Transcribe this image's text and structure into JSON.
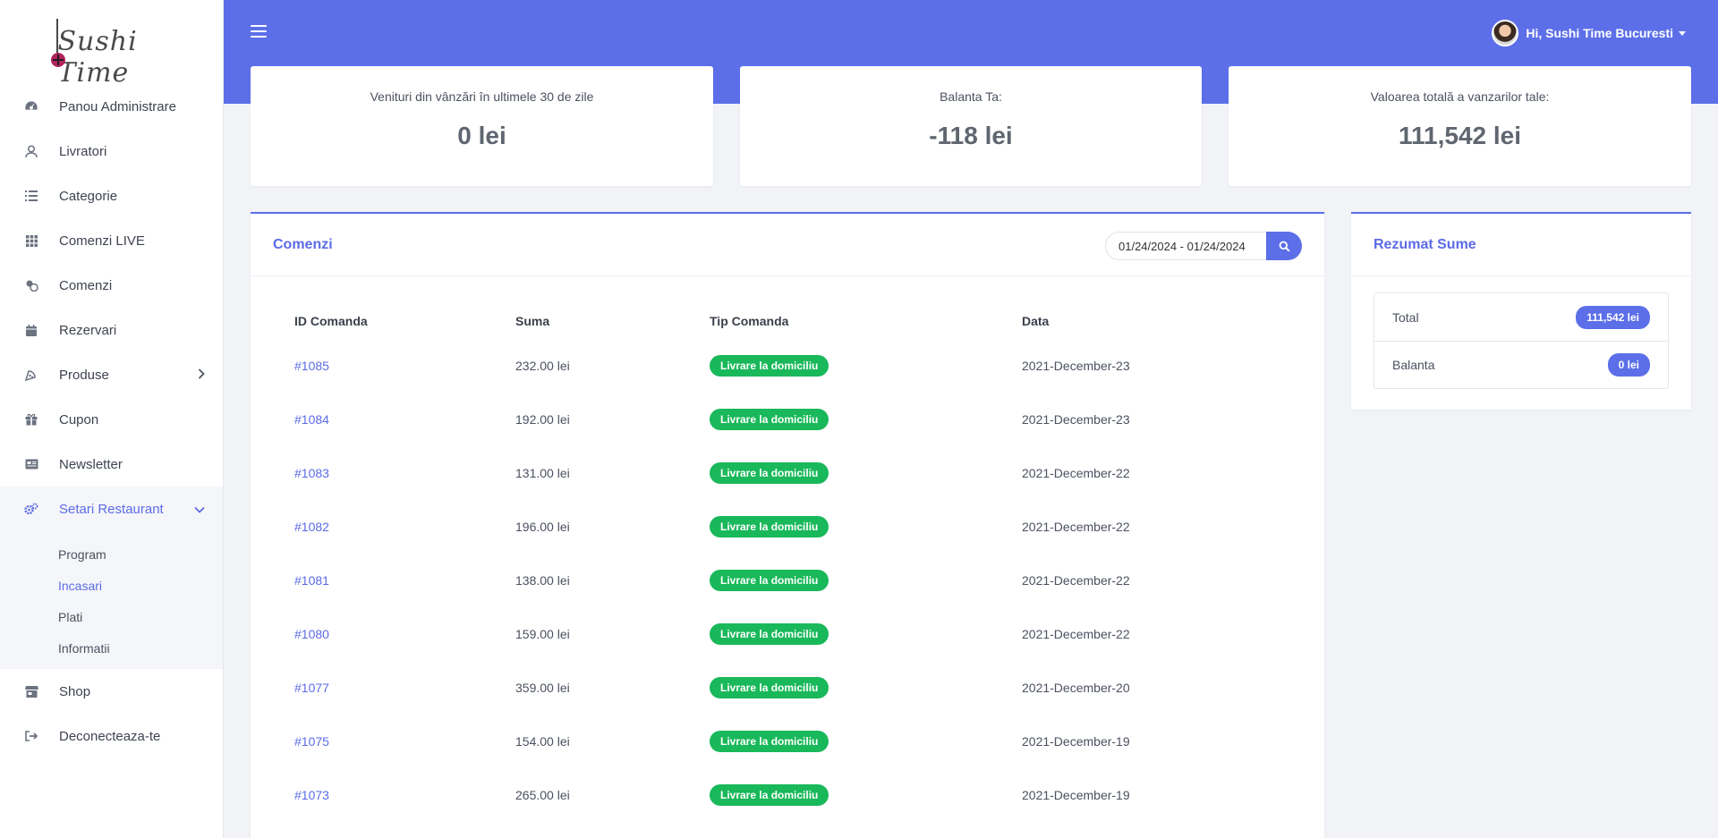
{
  "brand": {
    "logo_text": "Sushi Time"
  },
  "sidebar": {
    "items": [
      {
        "label": "Panou Administrare",
        "icon": "dashboard-gauge-icon"
      },
      {
        "label": "Livratori",
        "icon": "user-icon"
      },
      {
        "label": "Categorie",
        "icon": "list-icon"
      },
      {
        "label": "Comenzi LIVE",
        "icon": "grid-icon"
      },
      {
        "label": "Comenzi",
        "icon": "cookies-icon"
      },
      {
        "label": "Rezervari",
        "icon": "calendar-icon"
      },
      {
        "label": "Produse",
        "icon": "pizza-icon"
      },
      {
        "label": "Cupon",
        "icon": "gift-icon"
      },
      {
        "label": "Newsletter",
        "icon": "newspaper-icon"
      },
      {
        "label": "Setari Restaurant",
        "icon": "cogs-icon"
      },
      {
        "label": "Shop",
        "icon": "store-icon"
      },
      {
        "label": "Deconecteaza-te",
        "icon": "sign-out-icon"
      }
    ],
    "sub_items": [
      {
        "label": "Program"
      },
      {
        "label": "Incasari"
      },
      {
        "label": "Plati"
      },
      {
        "label": "Informatii"
      }
    ]
  },
  "header": {
    "greeting": "Hi, Sushi Time Bucuresti"
  },
  "stats": [
    {
      "label": "Venituri din vânzări în ultimele 30 de zile",
      "value": "0 lei"
    },
    {
      "label": "Balanta Ta:",
      "value": "-118 lei"
    },
    {
      "label": "Valoarea totală a vanzarilor tale:",
      "value": "111,542 lei"
    }
  ],
  "orders": {
    "title": "Comenzi",
    "date_range": "01/24/2024 - 01/24/2024",
    "columns": [
      "ID Comanda",
      "Suma",
      "Tip Comanda",
      "Data"
    ],
    "rows": [
      {
        "id": "#1085",
        "amount": "232.00 lei",
        "type": "Livrare la domiciliu",
        "date": "2021-December-23"
      },
      {
        "id": "#1084",
        "amount": "192.00 lei",
        "type": "Livrare la domiciliu",
        "date": "2021-December-23"
      },
      {
        "id": "#1083",
        "amount": "131.00 lei",
        "type": "Livrare la domiciliu",
        "date": "2021-December-22"
      },
      {
        "id": "#1082",
        "amount": "196.00 lei",
        "type": "Livrare la domiciliu",
        "date": "2021-December-22"
      },
      {
        "id": "#1081",
        "amount": "138.00 lei",
        "type": "Livrare la domiciliu",
        "date": "2021-December-22"
      },
      {
        "id": "#1080",
        "amount": "159.00 lei",
        "type": "Livrare la domiciliu",
        "date": "2021-December-22"
      },
      {
        "id": "#1077",
        "amount": "359.00 lei",
        "type": "Livrare la domiciliu",
        "date": "2021-December-20"
      },
      {
        "id": "#1075",
        "amount": "154.00 lei",
        "type": "Livrare la domiciliu",
        "date": "2021-December-19"
      },
      {
        "id": "#1073",
        "amount": "265.00 lei",
        "type": "Livrare la domiciliu",
        "date": "2021-December-19"
      }
    ]
  },
  "summary": {
    "title": "Rezumat Sume",
    "rows": [
      {
        "label": "Total",
        "value": "111,542 lei"
      },
      {
        "label": "Balanta",
        "value": "0 lei"
      }
    ]
  },
  "colors": {
    "accent": "#5c6fe8",
    "success": "#19b85a"
  }
}
